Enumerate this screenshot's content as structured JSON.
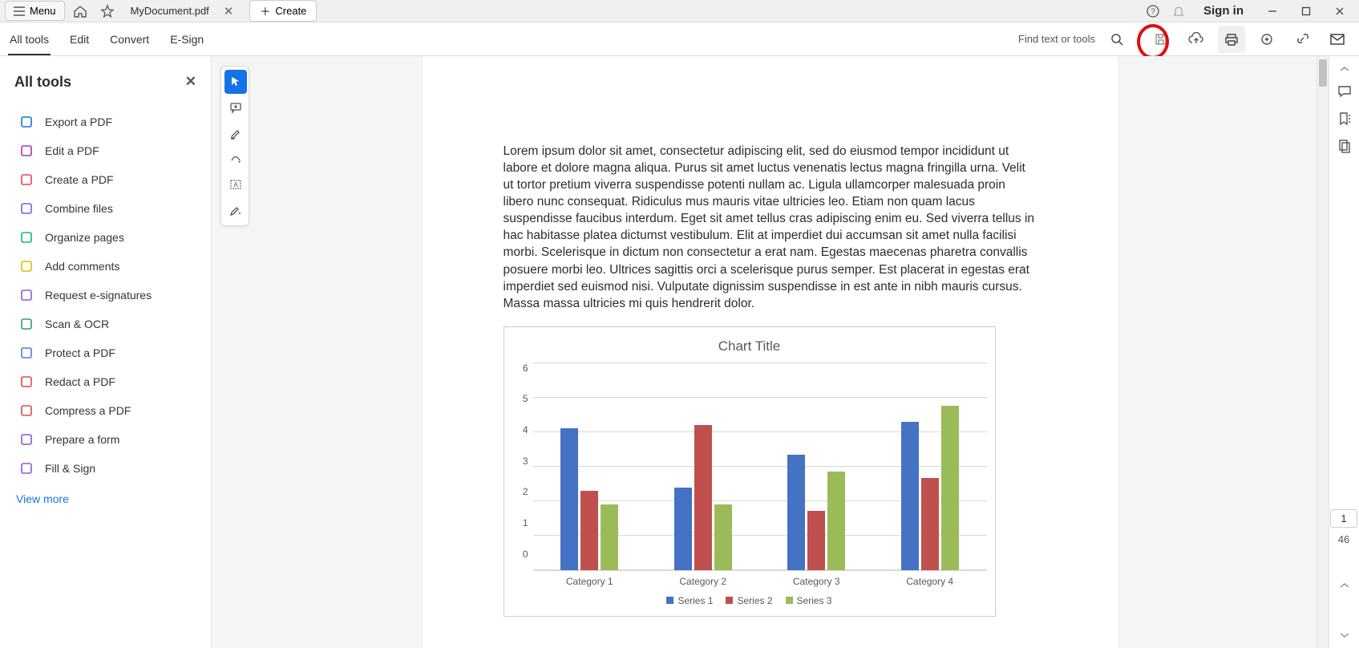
{
  "titlebar": {
    "menu_label": "Menu",
    "tab_name": "MyDocument.pdf",
    "create_label": "Create",
    "sign_in_label": "Sign in"
  },
  "secondbar": {
    "tabs": [
      "All tools",
      "Edit",
      "Convert",
      "E-Sign"
    ],
    "find_placeholder": "Find text or tools"
  },
  "sidebar": {
    "title": "All tools",
    "items": [
      {
        "label": "Export a PDF",
        "color": "#1473e6"
      },
      {
        "label": "Edit a PDF",
        "color": "#b130bd"
      },
      {
        "label": "Create a PDF",
        "color": "#e34850"
      },
      {
        "label": "Combine files",
        "color": "#6767ec"
      },
      {
        "label": "Organize pages",
        "color": "#12b886"
      },
      {
        "label": "Add comments",
        "color": "#e8b800"
      },
      {
        "label": "Request e-signatures",
        "color": "#9256d9"
      },
      {
        "label": "Scan & OCR",
        "color": "#2d9d78"
      },
      {
        "label": "Protect a PDF",
        "color": "#4b7bec"
      },
      {
        "label": "Redact a PDF",
        "color": "#e34850"
      },
      {
        "label": "Compress a PDF",
        "color": "#e34850"
      },
      {
        "label": "Prepare a form",
        "color": "#9256d9"
      },
      {
        "label": "Fill & Sign",
        "color": "#9256d9"
      }
    ],
    "view_more_label": "View more"
  },
  "document": {
    "paragraph": "Lorem ipsum dolor sit amet, consectetur adipiscing elit, sed do eiusmod tempor incididunt ut labore et dolore magna aliqua. Purus sit amet luctus venenatis lectus magna fringilla urna. Velit ut tortor pretium viverra suspendisse potenti nullam ac. Ligula ullamcorper malesuada proin libero nunc consequat. Ridiculus mus mauris vitae ultricies leo. Etiam non quam lacus suspendisse faucibus interdum. Eget sit amet tellus cras adipiscing enim eu. Sed viverra tellus in hac habitasse platea dictumst vestibulum. Elit at imperdiet dui accumsan sit amet nulla facilisi morbi. Scelerisque in dictum non consectetur a erat nam. Egestas maecenas pharetra convallis posuere morbi leo. Ultrices sagittis orci a scelerisque purus semper. Est placerat in egestas erat imperdiet sed euismod nisi. Vulputate dignissim suspendisse in est ante in nibh mauris cursus. Massa massa ultricies mi quis hendrerit dolor."
  },
  "chart_data": {
    "type": "bar",
    "title": "Chart Title",
    "categories": [
      "Category 1",
      "Category 2",
      "Category 3",
      "Category 4"
    ],
    "series": [
      {
        "name": "Series 1",
        "values": [
          4.3,
          2.5,
          3.5,
          4.5
        ],
        "color": "#4472c4"
      },
      {
        "name": "Series 2",
        "values": [
          2.4,
          4.4,
          1.8,
          2.8
        ],
        "color": "#c0504d"
      },
      {
        "name": "Series 3",
        "values": [
          2.0,
          2.0,
          3.0,
          5.0
        ],
        "color": "#9bbb59"
      }
    ],
    "ylim": [
      0,
      6
    ],
    "yticks": [
      0,
      1,
      2,
      3,
      4,
      5,
      6
    ],
    "xlabel": "",
    "ylabel": ""
  },
  "page_info": {
    "current": "1",
    "total": "46"
  }
}
